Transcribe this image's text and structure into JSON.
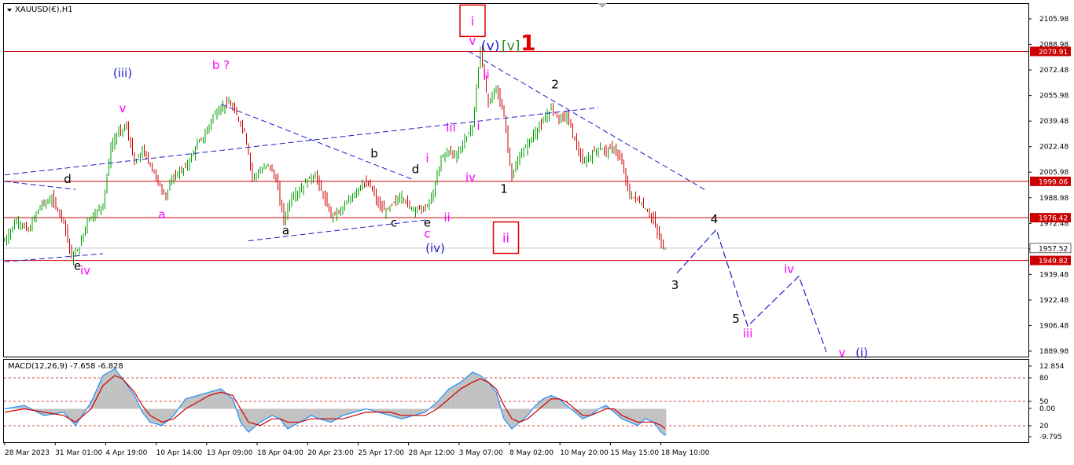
{
  "window": {
    "symbol_title": "XAUUSD(€),H1",
    "macd_title": "MACD(12,26,9) -7.658 -6.828"
  },
  "colors": {
    "bull_candle": "#00a000",
    "bear_candle": "#cc0000",
    "level_line": "#cc0000",
    "trend_line": "#1c1cc8",
    "wave_black": "#000000",
    "wave_magenta": "#ff00ff",
    "wave_blue": "#1c1cc8",
    "wave_green": "#2e8b20",
    "wave_red": "#e00000",
    "macd_hist": "#c0c0c0",
    "macd_line": "#1e90ff",
    "signal_line": "#cc0000"
  },
  "chart_data": [
    {
      "type": "candlestick",
      "title": "XAUUSD(€),H1",
      "ylim": [
        1889.98,
        2107.5
      ],
      "y_ticks": [
        "2105.98",
        "2088.98",
        "2072.48",
        "2055.98",
        "2039.48",
        "2022.48",
        "2005.98",
        "1988.98",
        "1972.48",
        "1955.98",
        "1939.48",
        "1922.48",
        "1906.48",
        "1889.98"
      ],
      "x_labels": [
        "28 Mar 2023",
        "31 Mar 01:00",
        "4 Apr 19:00",
        "10 Apr 14:00",
        "13 Apr 09:00",
        "18 Apr 04:00",
        "20 Apr 23:00",
        "25 Apr 17:00",
        "28 Apr 12:00",
        "3 May 07:00",
        "8 May 02:00",
        "10 May 20:00",
        "15 May 15:00",
        "18 May 10:00"
      ],
      "price_path": [
        [
          0,
          1962
        ],
        [
          3,
          1975
        ],
        [
          6,
          1968
        ],
        [
          9,
          1984
        ],
        [
          12,
          1988
        ],
        [
          15,
          1975
        ],
        [
          17,
          1951
        ],
        [
          19,
          1958
        ],
        [
          21,
          1975
        ],
        [
          23,
          1979
        ],
        [
          25,
          1985
        ],
        [
          27,
          2020
        ],
        [
          29,
          2030
        ],
        [
          31,
          2033
        ],
        [
          33,
          2010
        ],
        [
          35,
          2018
        ],
        [
          37,
          2010
        ],
        [
          39,
          1998
        ],
        [
          41,
          1990
        ],
        [
          43,
          2003
        ],
        [
          45,
          2005
        ],
        [
          47,
          2012
        ],
        [
          49,
          2022
        ],
        [
          51,
          2028
        ],
        [
          53,
          2040
        ],
        [
          55,
          2045
        ],
        [
          57,
          2048
        ],
        [
          59,
          2040
        ],
        [
          61,
          2030
        ],
        [
          63,
          2002
        ],
        [
          65,
          2005
        ],
        [
          67,
          2010
        ],
        [
          69,
          2000
        ],
        [
          71,
          1975
        ],
        [
          73,
          1990
        ],
        [
          75,
          1993
        ],
        [
          77,
          2000
        ],
        [
          79,
          2003
        ],
        [
          81,
          1990
        ],
        [
          83,
          1978
        ],
        [
          85,
          1980
        ],
        [
          87,
          1985
        ],
        [
          89,
          1992
        ],
        [
          91,
          1998
        ],
        [
          93,
          1996
        ],
        [
          95,
          1985
        ],
        [
          97,
          1980
        ],
        [
          99,
          1986
        ],
        [
          101,
          1990
        ],
        [
          103,
          1983
        ],
        [
          105,
          1982
        ],
        [
          107,
          1982
        ],
        [
          109,
          1991
        ],
        [
          111,
          2014
        ],
        [
          113,
          2018
        ],
        [
          115,
          2015
        ],
        [
          117,
          2025
        ],
        [
          119,
          2033
        ],
        [
          121,
          2081
        ],
        [
          123,
          2046
        ],
        [
          125,
          2058
        ],
        [
          127,
          2040
        ],
        [
          129,
          2001
        ],
        [
          131,
          2015
        ],
        [
          133,
          2022
        ],
        [
          135,
          2030
        ],
        [
          137,
          2036
        ],
        [
          139,
          2045
        ],
        [
          141,
          2038
        ],
        [
          143,
          2040
        ],
        [
          145,
          2025
        ],
        [
          147,
          2010
        ],
        [
          149,
          2015
        ],
        [
          151,
          2020
        ],
        [
          153,
          2018
        ],
        [
          155,
          2020
        ],
        [
          157,
          2010
        ],
        [
          159,
          1990
        ],
        [
          161,
          1988
        ],
        [
          163,
          1982
        ],
        [
          165,
          1975
        ],
        [
          167,
          1960
        ],
        [
          168,
          1957.52
        ]
      ],
      "price_levels": [
        {
          "label": "2079.91",
          "value": 2079.91
        },
        {
          "label": "1999.06",
          "value": 1999.06
        },
        {
          "label": "1976.42",
          "value": 1976.42
        },
        {
          "label": "1949.82",
          "value": 1949.82
        }
      ],
      "current_price": {
        "label": "1957.52",
        "value": 1957.52
      },
      "trend_lines": [
        {
          "from": [
            0,
            2003
          ],
          "to": [
            151,
            2045
          ]
        },
        {
          "from": [
            0,
            1999
          ],
          "to": [
            18,
            1994
          ]
        },
        {
          "from": [
            0,
            1949
          ],
          "to": [
            25,
            1954
          ]
        },
        {
          "from": [
            55,
            2047
          ],
          "to": [
            104,
            2000
          ]
        },
        {
          "from": [
            62,
            1962
          ],
          "to": [
            107,
            1975
          ]
        },
        {
          "from": [
            118,
            2080
          ],
          "to": [
            178,
            1994
          ]
        }
      ],
      "projection": [
        [
          171,
          1942
        ],
        [
          181,
          1969
        ],
        [
          189,
          1909
        ],
        [
          202,
          1940
        ],
        [
          209,
          1893
        ]
      ],
      "wave_labels": [
        {
          "text": "d",
          "color": "wave_black",
          "x": 16,
          "y": 1998
        },
        {
          "text": "e",
          "color": "wave_black",
          "x": 18.5,
          "y": 1944
        },
        {
          "text": "iv",
          "color": "wave_magenta",
          "x": 20.5,
          "y": 1941
        },
        {
          "text": "(iii)",
          "color": "wave_blue",
          "x": 30,
          "y": 2064
        },
        {
          "text": "v",
          "color": "wave_magenta",
          "x": 30,
          "y": 2042
        },
        {
          "text": "a",
          "color": "wave_magenta",
          "x": 40,
          "y": 1976
        },
        {
          "text": "b ?",
          "color": "wave_magenta",
          "x": 55,
          "y": 2069
        },
        {
          "text": "a",
          "color": "wave_black",
          "x": 71.5,
          "y": 1966
        },
        {
          "text": "b",
          "color": "wave_black",
          "x": 94,
          "y": 2014
        },
        {
          "text": "c",
          "color": "wave_black",
          "x": 99,
          "y": 1971
        },
        {
          "text": "d",
          "color": "wave_black",
          "x": 104.5,
          "y": 2004
        },
        {
          "text": "e",
          "color": "wave_black",
          "x": 107.5,
          "y": 1971
        },
        {
          "text": "c",
          "color": "wave_magenta",
          "x": 107.5,
          "y": 1964
        },
        {
          "text": "(iv)",
          "color": "wave_blue",
          "x": 109.5,
          "y": 1955
        },
        {
          "text": "i",
          "color": "wave_magenta",
          "x": 107.5,
          "y": 2011
        },
        {
          "text": "ii",
          "color": "wave_magenta",
          "x": 112.5,
          "y": 1974
        },
        {
          "text": "iii",
          "color": "wave_magenta",
          "x": 113.5,
          "y": 2030
        },
        {
          "text": "iv",
          "color": "wave_magenta",
          "x": 118.5,
          "y": 1999
        },
        {
          "text": "i",
          "color": "wave_magenta",
          "x": 120.5,
          "y": 2031
        },
        {
          "text": "ii",
          "color": "wave_magenta",
          "x": 122.5,
          "y": 2063
        },
        {
          "text": "v",
          "color": "wave_magenta",
          "x": 119,
          "y": 2084
        },
        {
          "text": "1",
          "color": "wave_black",
          "x": 127,
          "y": 1992
        },
        {
          "text": "2",
          "color": "wave_black",
          "x": 140,
          "y": 2057
        },
        {
          "text": "3",
          "color": "wave_black",
          "x": 170.5,
          "y": 1932
        },
        {
          "text": "4",
          "color": "wave_black",
          "x": 180.5,
          "y": 1973
        },
        {
          "text": "5",
          "color": "wave_black",
          "x": 186,
          "y": 1911
        },
        {
          "text": "iii",
          "color": "wave_magenta",
          "x": 189,
          "y": 1902
        },
        {
          "text": "iv",
          "color": "wave_magenta",
          "x": 199.5,
          "y": 1942
        },
        {
          "text": "v",
          "color": "wave_magenta",
          "x": 213,
          "y": 1890
        },
        {
          "text": "(i)",
          "color": "wave_blue",
          "x": 218,
          "y": 1890
        }
      ],
      "boxed_labels": [
        {
          "text": "i",
          "color": "wave_magenta",
          "x": 119,
          "y": 2099
        },
        {
          "text": "ii",
          "color": "wave_magenta",
          "x": 127.5,
          "y": 1964
        }
      ],
      "degree_label": [
        {
          "text": "(v)",
          "color": "wave_blue"
        },
        {
          "text": "[v]",
          "color": "wave_green"
        },
        {
          "text": "1",
          "color": "wave_red"
        }
      ]
    },
    {
      "type": "histogram+line",
      "title": "MACD(12,26,9) -7.658 -6.828",
      "ylim": [
        -9.795,
        12.854
      ],
      "y_ticks": [
        "12.854",
        "80",
        "50",
        "0.00",
        "20",
        "-9.795"
      ],
      "levels": [
        80,
        50,
        20
      ],
      "macd_path": [
        [
          0,
          0
        ],
        [
          5,
          1
        ],
        [
          10,
          -2
        ],
        [
          15,
          -1
        ],
        [
          18,
          -5
        ],
        [
          22,
          2
        ],
        [
          25,
          10
        ],
        [
          28,
          12
        ],
        [
          30,
          9
        ],
        [
          33,
          4
        ],
        [
          35,
          -1
        ],
        [
          37,
          -4
        ],
        [
          40,
          -5
        ],
        [
          43,
          -2
        ],
        [
          46,
          3
        ],
        [
          49,
          4
        ],
        [
          52,
          5
        ],
        [
          55,
          6
        ],
        [
          58,
          3
        ],
        [
          60,
          -4
        ],
        [
          62,
          -7
        ],
        [
          65,
          -4
        ],
        [
          68,
          -2
        ],
        [
          70,
          -3
        ],
        [
          72,
          -6
        ],
        [
          75,
          -4
        ],
        [
          78,
          -2
        ],
        [
          80,
          -3
        ],
        [
          83,
          -4
        ],
        [
          86,
          -2
        ],
        [
          89,
          -1
        ],
        [
          92,
          0
        ],
        [
          95,
          -1
        ],
        [
          98,
          -2
        ],
        [
          101,
          -3
        ],
        [
          104,
          -2
        ],
        [
          107,
          -1
        ],
        [
          110,
          2
        ],
        [
          113,
          6
        ],
        [
          116,
          8
        ],
        [
          119,
          11
        ],
        [
          121,
          10
        ],
        [
          123,
          8
        ],
        [
          125,
          5
        ],
        [
          127,
          -3
        ],
        [
          129,
          -6
        ],
        [
          131,
          -4
        ],
        [
          133,
          -2
        ],
        [
          135,
          1
        ],
        [
          137,
          3
        ],
        [
          139,
          4
        ],
        [
          141,
          3
        ],
        [
          143,
          1
        ],
        [
          145,
          -1
        ],
        [
          147,
          -3
        ],
        [
          149,
          -2
        ],
        [
          151,
          0
        ],
        [
          153,
          1
        ],
        [
          155,
          -1
        ],
        [
          157,
          -3
        ],
        [
          159,
          -4
        ],
        [
          161,
          -5
        ],
        [
          163,
          -3
        ],
        [
          165,
          -4
        ],
        [
          167,
          -7
        ],
        [
          168,
          -8
        ]
      ],
      "signal_path": [
        [
          0,
          -1
        ],
        [
          5,
          0
        ],
        [
          10,
          -1
        ],
        [
          15,
          -2
        ],
        [
          18,
          -4
        ],
        [
          22,
          0
        ],
        [
          25,
          7
        ],
        [
          28,
          10
        ],
        [
          30,
          9
        ],
        [
          33,
          5
        ],
        [
          35,
          1
        ],
        [
          37,
          -2
        ],
        [
          40,
          -4
        ],
        [
          43,
          -3
        ],
        [
          46,
          0
        ],
        [
          49,
          2
        ],
        [
          52,
          4
        ],
        [
          55,
          5
        ],
        [
          58,
          4
        ],
        [
          60,
          0
        ],
        [
          62,
          -4
        ],
        [
          65,
          -5
        ],
        [
          68,
          -3
        ],
        [
          70,
          -3
        ],
        [
          72,
          -4
        ],
        [
          75,
          -4
        ],
        [
          78,
          -3
        ],
        [
          80,
          -3
        ],
        [
          83,
          -3
        ],
        [
          86,
          -3
        ],
        [
          89,
          -2
        ],
        [
          92,
          -1
        ],
        [
          95,
          -1
        ],
        [
          98,
          -1
        ],
        [
          101,
          -2
        ],
        [
          104,
          -2
        ],
        [
          107,
          -2
        ],
        [
          110,
          0
        ],
        [
          113,
          3
        ],
        [
          116,
          6
        ],
        [
          119,
          8
        ],
        [
          121,
          9
        ],
        [
          123,
          8
        ],
        [
          125,
          6
        ],
        [
          127,
          1
        ],
        [
          129,
          -3
        ],
        [
          131,
          -4
        ],
        [
          133,
          -3
        ],
        [
          135,
          -1
        ],
        [
          137,
          1
        ],
        [
          139,
          3
        ],
        [
          141,
          3
        ],
        [
          143,
          2
        ],
        [
          145,
          0
        ],
        [
          147,
          -2
        ],
        [
          149,
          -2
        ],
        [
          151,
          -1
        ],
        [
          153,
          0
        ],
        [
          155,
          0
        ],
        [
          157,
          -2
        ],
        [
          159,
          -3
        ],
        [
          161,
          -4
        ],
        [
          163,
          -4
        ],
        [
          165,
          -4
        ],
        [
          167,
          -5
        ],
        [
          168,
          -6
        ]
      ]
    }
  ]
}
